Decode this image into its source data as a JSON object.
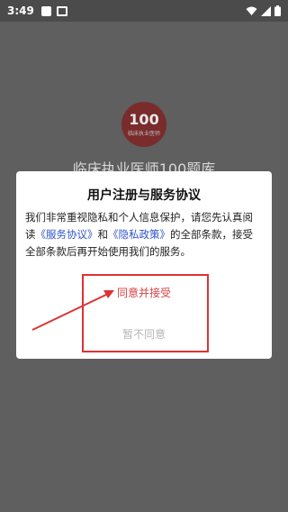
{
  "status_bar": {
    "time": "3:49",
    "icons": [
      "notification-box-icon",
      "image-icon",
      "wifi-icon",
      "signal-icon",
      "battery-icon"
    ]
  },
  "background": {
    "logo_number": "100",
    "logo_subtitle": "临床执业医师",
    "app_title": "临床执业医师100题库"
  },
  "dialog": {
    "title": "用户注册与服务协议",
    "body_part1": "我们非常重视隐私和个人信息保护，请您先认真阅读",
    "link_service": "《服务协议》",
    "body_and": "和",
    "link_privacy": "《隐私政策》",
    "body_part2": "的全部条款，接受全部条款后再开始使用我们的服务。",
    "accept_label": "同意并接受",
    "decline_label": "暂不同意"
  },
  "colors": {
    "accent_red": "#d34343",
    "link_blue": "#2f52c8",
    "annotation_red": "#dd3333"
  }
}
